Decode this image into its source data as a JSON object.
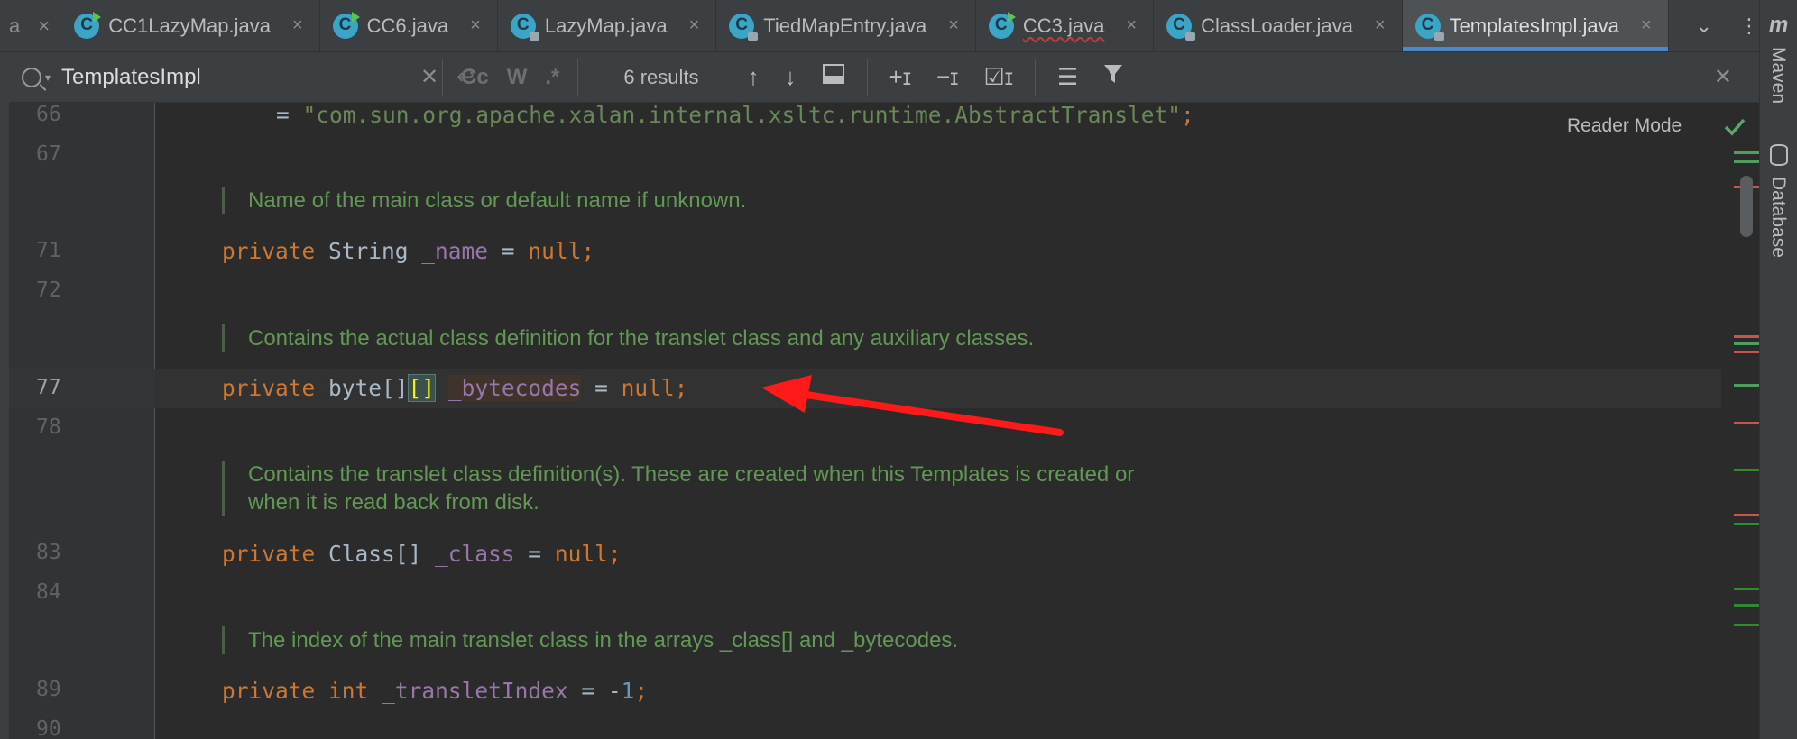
{
  "tabs": {
    "partial_left": "a",
    "items": [
      {
        "label": "CC1LazyMap.java",
        "icon": "java-class-run-icon"
      },
      {
        "label": "CC6.java",
        "icon": "java-class-run-icon"
      },
      {
        "label": "LazyMap.java",
        "icon": "java-class-locked-icon"
      },
      {
        "label": "TiedMapEntry.java",
        "icon": "java-class-locked-icon"
      },
      {
        "label": "CC3.java",
        "icon": "java-class-run-icon"
      },
      {
        "label": "ClassLoader.java",
        "icon": "java-class-locked-icon"
      },
      {
        "label": "TemplatesImpl.java",
        "icon": "java-class-locked-icon",
        "active": true
      }
    ],
    "close_glyph": "×",
    "more_glyph": "⌄",
    "kebab_glyph": "⋮"
  },
  "right_strip": {
    "maven_label": "Maven",
    "database_label": "Database",
    "m_glyph": "m"
  },
  "search": {
    "query": "TemplatesImpl",
    "match_case": "Cc",
    "whole_words": "W",
    "regex": ".*",
    "results": "6 results"
  },
  "editor": {
    "reader_mode": "Reader Mode",
    "line_numbers": {
      "l66": "66",
      "l67": "67",
      "l71": "71",
      "l72": "72",
      "l77": "77",
      "l78": "78",
      "l83": "83",
      "l84": "84",
      "l89": "89",
      "l90": "90"
    },
    "line66": {
      "eq": "= ",
      "string": "\"com.sun.org.apache.xalan.internal.xsltc.runtime.AbstractTranslet\"",
      "semi": ";"
    },
    "doc1": "Name of the main class or default name if unknown.",
    "line71": {
      "kw": "private",
      "type": " String ",
      "field": "_name",
      "rest": " = ",
      "nul": "null",
      "semi": ";"
    },
    "doc2": "Contains the actual class definition for the translet class and any auxiliary classes.",
    "line77": {
      "kw": "private",
      "type": " byte",
      "br1": "[]",
      "br2": "[]",
      "space": " ",
      "field": "_bytecodes",
      "rest": " = ",
      "nul": "null",
      "semi": ";"
    },
    "doc3a": "Contains the translet class definition(s). These are created when this Templates is created or",
    "doc3b": "when it is read back from disk.",
    "line83": {
      "kw": "private",
      "type": " Class[] ",
      "field": "_class",
      "rest": " = ",
      "nul": "null",
      "semi": ";"
    },
    "doc4": "The index of the main translet class in the arrays _class[] and _bytecodes.",
    "line89": {
      "kw": "private",
      "kw2": "int",
      "field": "_transletIndex",
      "rest": " = -",
      "num": "1",
      "semi": ";"
    }
  },
  "colors": {
    "accent": "#4a88c7",
    "arrow": "#ff1a1a",
    "doc": "#629755",
    "keyword": "#cc7832"
  }
}
